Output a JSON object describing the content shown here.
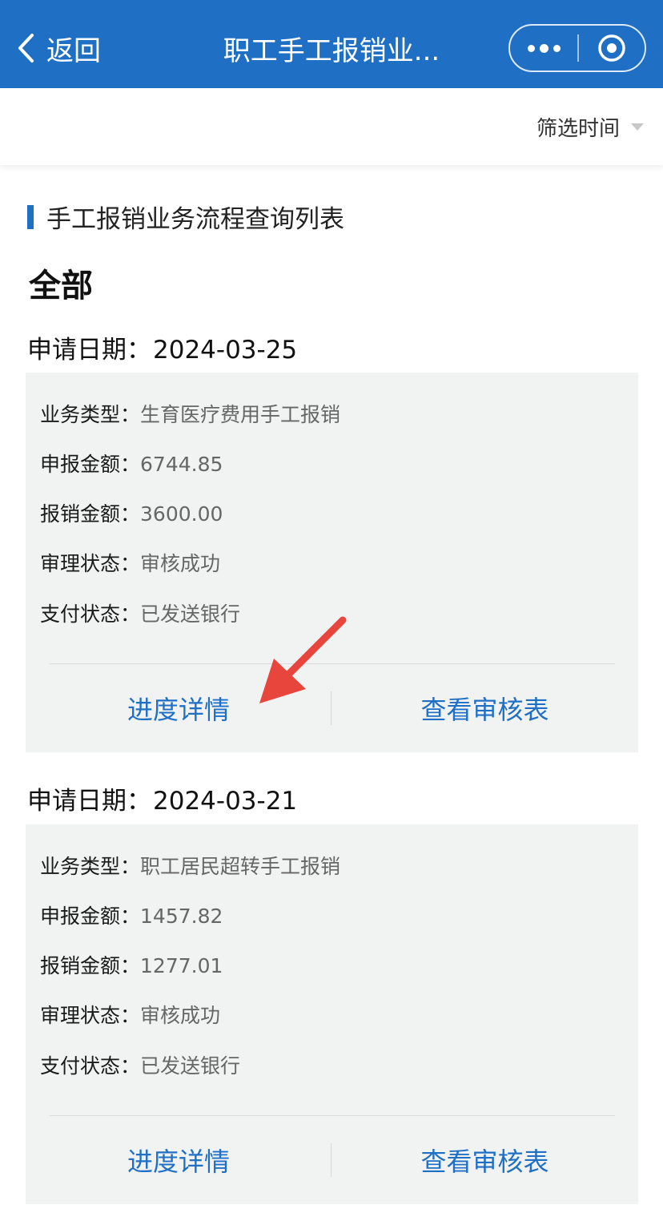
{
  "navbar": {
    "back_label": "返回",
    "title": "职工手工报销业...",
    "color": "#1f6fc5"
  },
  "filter": {
    "label": "筛选时间"
  },
  "section": {
    "title": "手工报销业务流程查询列表"
  },
  "group": {
    "title": "全部"
  },
  "records": [
    {
      "date_label": "申请日期：",
      "date": "2024-03-25",
      "fields": [
        {
          "key": "业务类型：",
          "value": "生育医疗费用手工报销"
        },
        {
          "key": "申报金额：",
          "value": "6744.85"
        },
        {
          "key": "报销金额：",
          "value": "3600.00"
        },
        {
          "key": "审理状态：",
          "value": "审核成功"
        },
        {
          "key": "支付状态：",
          "value": "已发送银行"
        }
      ],
      "actions": {
        "progress": "进度详情",
        "review": "查看审核表"
      }
    },
    {
      "date_label": "申请日期：",
      "date": "2024-03-21",
      "fields": [
        {
          "key": "业务类型：",
          "value": "职工居民超转手工报销"
        },
        {
          "key": "申报金额：",
          "value": "1457.82"
        },
        {
          "key": "报销金额：",
          "value": "1277.01"
        },
        {
          "key": "审理状态：",
          "value": "审核成功"
        },
        {
          "key": "支付状态：",
          "value": "已发送银行"
        }
      ],
      "actions": {
        "progress": "进度详情",
        "review": "查看审核表"
      }
    }
  ],
  "annotation": {
    "arrow_color": "#e8453c"
  }
}
